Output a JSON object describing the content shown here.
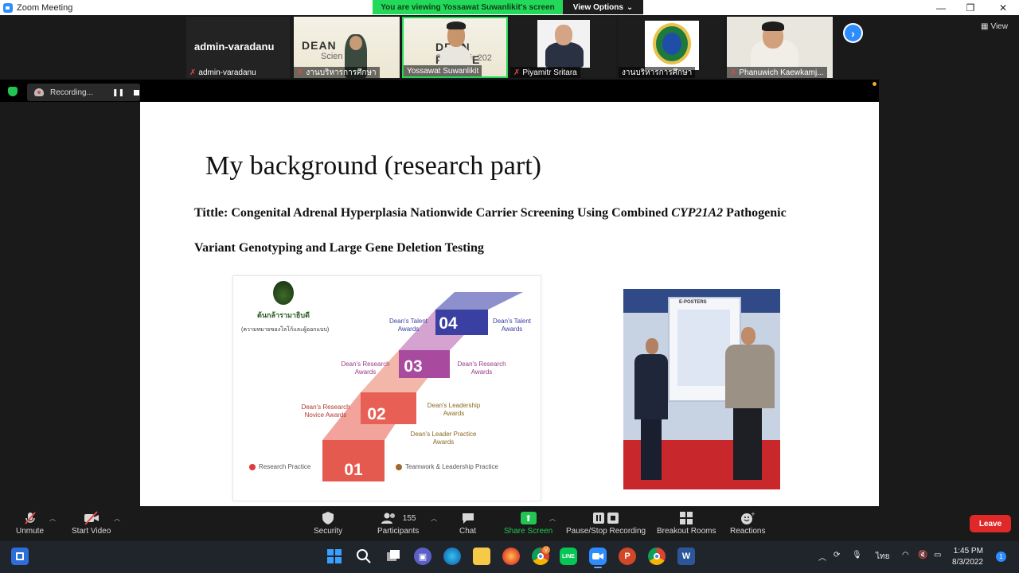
{
  "window": {
    "title": "Zoom Meeting",
    "controls": {
      "minimize": "—",
      "restore": "❐",
      "close": "✕"
    }
  },
  "banner": {
    "viewing_text": "You are viewing Yossawat Suwanlikit's screen",
    "view_options_label": "View Options",
    "view_options_caret": "⌄"
  },
  "participants": [
    {
      "name": "admin-varadanu",
      "display_name": "admin-varadanu",
      "muted": true
    },
    {
      "name": "งานบริหารการศึกษา",
      "muted": true,
      "poster_line1": "DEAN",
      "poster_line2": "Scien"
    },
    {
      "name": "Yossawat Suwanlikit",
      "muted": false,
      "poster_line1": "DEAN PARTIE",
      "poster_line2": "Scien   Fair 202"
    },
    {
      "name": "Piyamitr Sritara",
      "muted": true
    },
    {
      "name": "งานบริหารการศึกษา",
      "muted": false
    },
    {
      "name": "Phanuwich Kaewkamj...",
      "muted": true
    }
  ],
  "strip": {
    "next_icon": "›",
    "view_label": "View"
  },
  "recording": {
    "label": "Recording...",
    "pause_glyph": "❚❚"
  },
  "slide": {
    "heading": "My background (research part)",
    "title_prefix": "Tittle: Congenital Adrenal Hyperplasia Nationwide Carrier Screening Using Combined ",
    "title_gene": "CYP21A2",
    "title_suffix": " Pathogenic",
    "title_line2": "Variant Genotyping and Large Gene Deletion Testing",
    "program_name": "ต้นกล้ารามาธิบดี",
    "program_subtitle": "(ความหมายของโลโก้และผู้ออกแบบ)",
    "steps": [
      {
        "num": "01",
        "left_label": "Research Practice",
        "right_label": "Teamwork & Leadership Practice"
      },
      {
        "num": "02",
        "left_label": "Dean's Research Novice Awards",
        "right_label": "Dean's Leadership Awards",
        "right_label2": "Dean's Leader Practice Awards"
      },
      {
        "num": "03",
        "left_label": "Dean's Research Awards",
        "right_label": "Dean's Research Awards"
      },
      {
        "num": "04",
        "left_label": "Dean's Talent Awards",
        "right_label": "Dean's Talent Awards"
      }
    ],
    "photo_sign": "E-POSTERS"
  },
  "toolbar": {
    "unmute": "Unmute",
    "start_video": "Start Video",
    "security": "Security",
    "participants": "Participants",
    "participants_count": "155",
    "chat": "Chat",
    "share_screen": "Share Screen",
    "pause_stop_recording": "Pause/Stop Recording",
    "breakout_rooms": "Breakout Rooms",
    "reactions": "Reactions",
    "leave": "Leave"
  },
  "taskbar": {
    "time": "1:45 PM",
    "date": "8/3/2022",
    "lang": "ไทย",
    "notifications": "1",
    "chrome_badge": "V",
    "zoom_app_badge": "9"
  }
}
